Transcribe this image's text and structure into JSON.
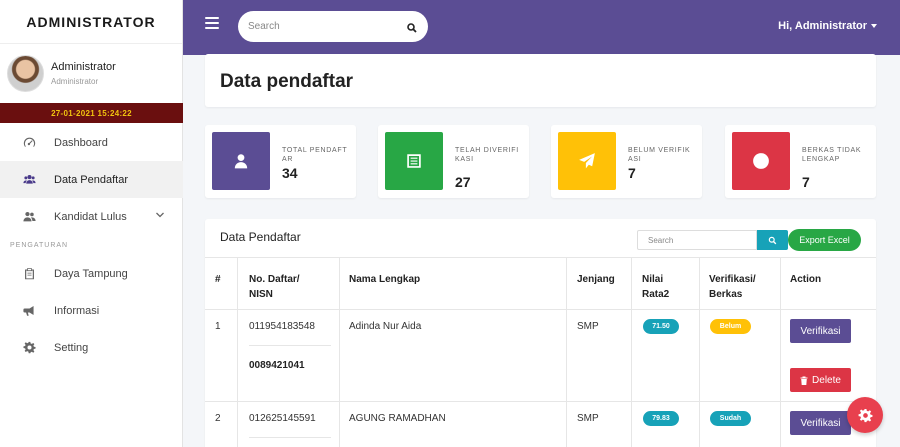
{
  "sidebar": {
    "brand": "ADMINISTRATOR",
    "user_name": "Administrator",
    "user_role": "Administrator",
    "clock": "27-01-2021 15:24:22",
    "items": [
      {
        "label": "Dashboard",
        "icon": "dashboard-gauge-icon"
      },
      {
        "label": "Data Pendaftar",
        "icon": "users-icon"
      },
      {
        "label": "Kandidat Lulus",
        "icon": "user-group-icon"
      }
    ],
    "section_label": "PENGATURAN",
    "settings_items": [
      {
        "label": "Daya Tampung",
        "icon": "clipboard-icon"
      },
      {
        "label": "Informasi",
        "icon": "megaphone-icon"
      },
      {
        "label": "Setting",
        "icon": "gear-icon"
      }
    ]
  },
  "topbar": {
    "search_placeholder": "Search",
    "user_greeting": "Hi, Administrator"
  },
  "page": {
    "title": "Data pendaftar"
  },
  "stats": [
    {
      "label": "TOTAL PENDAFTAR",
      "value": "34",
      "color": "#5b4d94",
      "icon": "user-icon"
    },
    {
      "label": "TELAH DIVERIFIKASI",
      "value": "27",
      "color": "#28a745",
      "icon": "document-icon"
    },
    {
      "label": "BELUM VERIFIKASI",
      "value": "7",
      "color": "#ffc107",
      "icon": "paper-plane-icon"
    },
    {
      "label": "BERKAS TIDAK LENGKAP",
      "value": "7",
      "color": "#dc3545",
      "icon": "circle-icon"
    }
  ],
  "table": {
    "title": "Data Pendaftar",
    "search_placeholder": "Search",
    "export_label": "Export Excel",
    "headers": {
      "num": "#",
      "no_daftar_1": "No. Daftar/",
      "no_daftar_2": "NISN",
      "nama": "Nama Lengkap",
      "jenjang": "Jenjang",
      "nilai_1": "Nilai",
      "nilai_2": "Rata2",
      "verif_1": "Verifikasi/",
      "verif_2": "Berkas",
      "action": "Action"
    },
    "rows": [
      {
        "num": "1",
        "no_daftar": "011954183548",
        "nisn": "0089421041",
        "nama": "Adinda Nur Aida",
        "jenjang": "SMP",
        "nilai": "71.50",
        "status": "Belum",
        "verify_label": "Verifikasi",
        "delete_label": "Delete"
      },
      {
        "num": "2",
        "no_daftar": "012625145591",
        "nama": "AGUNG RAMADHAN",
        "jenjang": "SMP",
        "nilai": "79.83",
        "status": "Sudah",
        "verify_label": "Verifikasi"
      }
    ]
  }
}
